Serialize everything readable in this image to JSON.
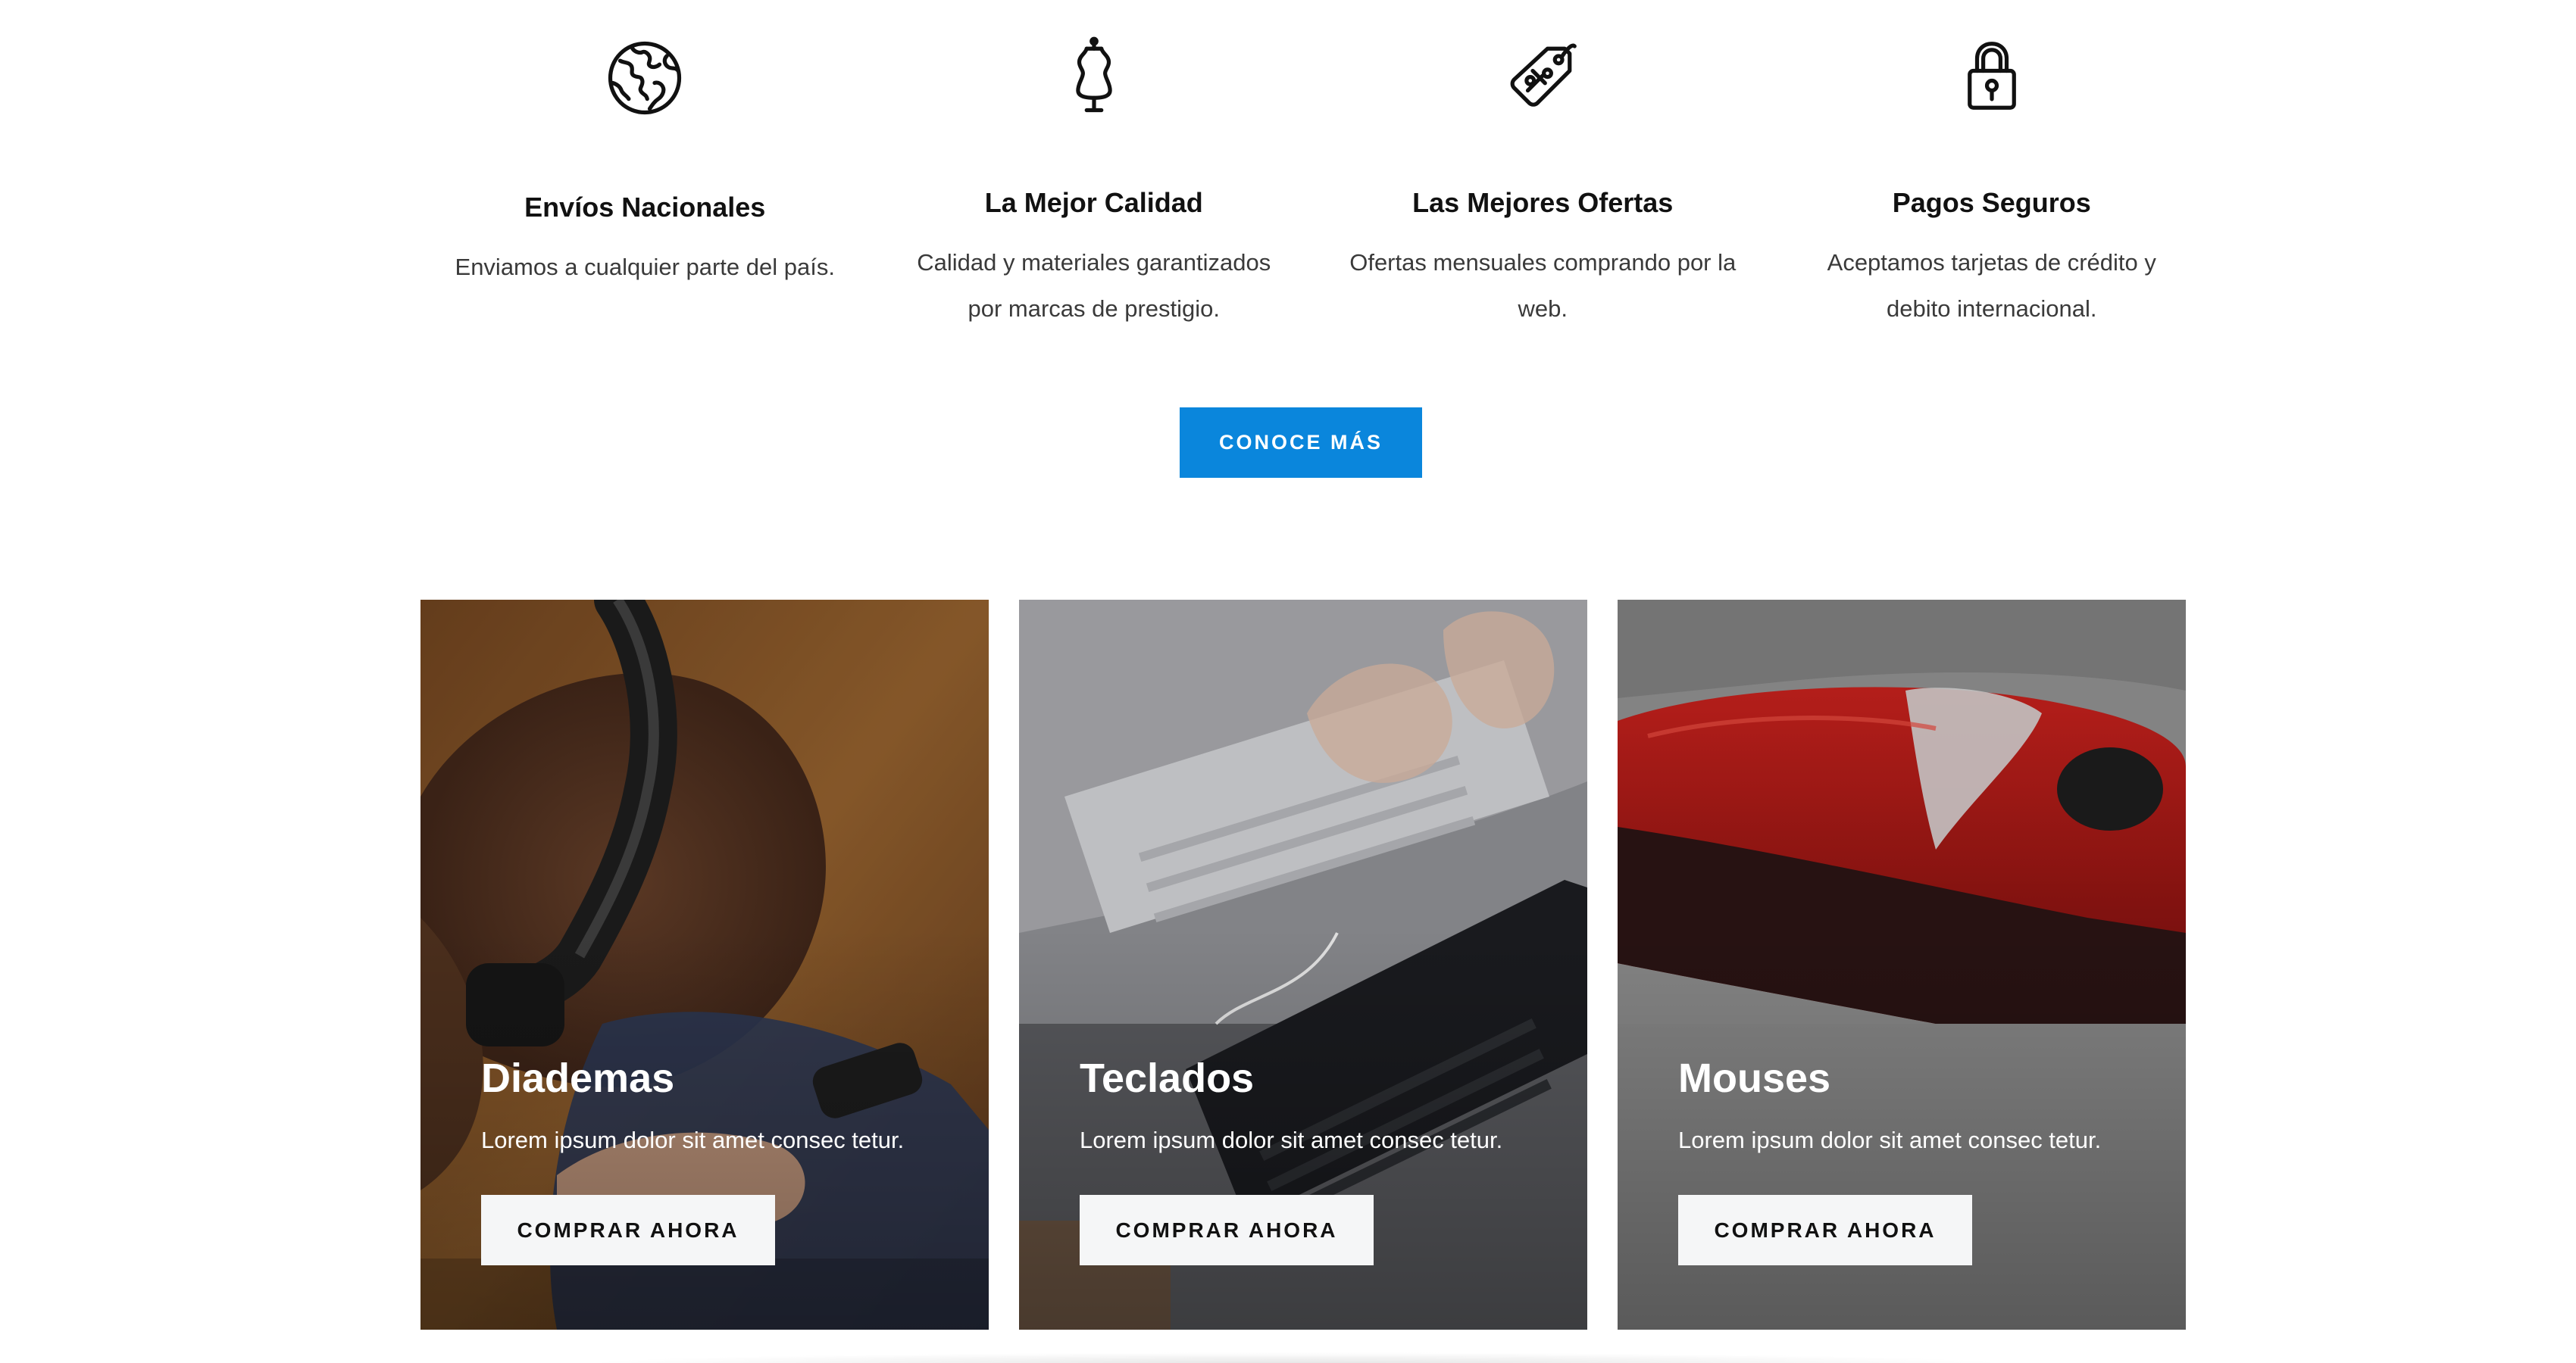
{
  "features": [
    {
      "icon": "globe-icon",
      "title": "Envíos Nacionales",
      "desc": "Enviamos a cualquier parte del país."
    },
    {
      "icon": "mannequin-icon",
      "title": "La Mejor Calidad",
      "desc": "Calidad y materiales garantizados por marcas de prestigio."
    },
    {
      "icon": "price-tag-icon",
      "title": "Las Mejores Ofertas",
      "desc": "Ofertas mensuales comprando por la web."
    },
    {
      "icon": "padlock-icon",
      "title": "Pagos Seguros",
      "desc": "Aceptamos tarjetas de crédito y debito internacional."
    }
  ],
  "more_button": {
    "label": "CONOCE MÁS"
  },
  "cards": [
    {
      "name": "Diademas",
      "text": "Lorem ipsum dolor sit amet consec tetur.",
      "button": "COMPRAR AHORA",
      "image": "headphones-photo"
    },
    {
      "name": "Teclados",
      "text": "Lorem ipsum dolor sit amet consec tetur.",
      "button": "COMPRAR AHORA",
      "image": "keyboards-photo"
    },
    {
      "name": "Mouses",
      "text": "Lorem ipsum dolor sit amet consec tetur.",
      "button": "COMPRAR AHORA",
      "image": "red-mouse-photo"
    }
  ],
  "colors": {
    "accent": "#0a86dc",
    "button_light": "#f5f6f7",
    "text_dark": "#111111"
  }
}
